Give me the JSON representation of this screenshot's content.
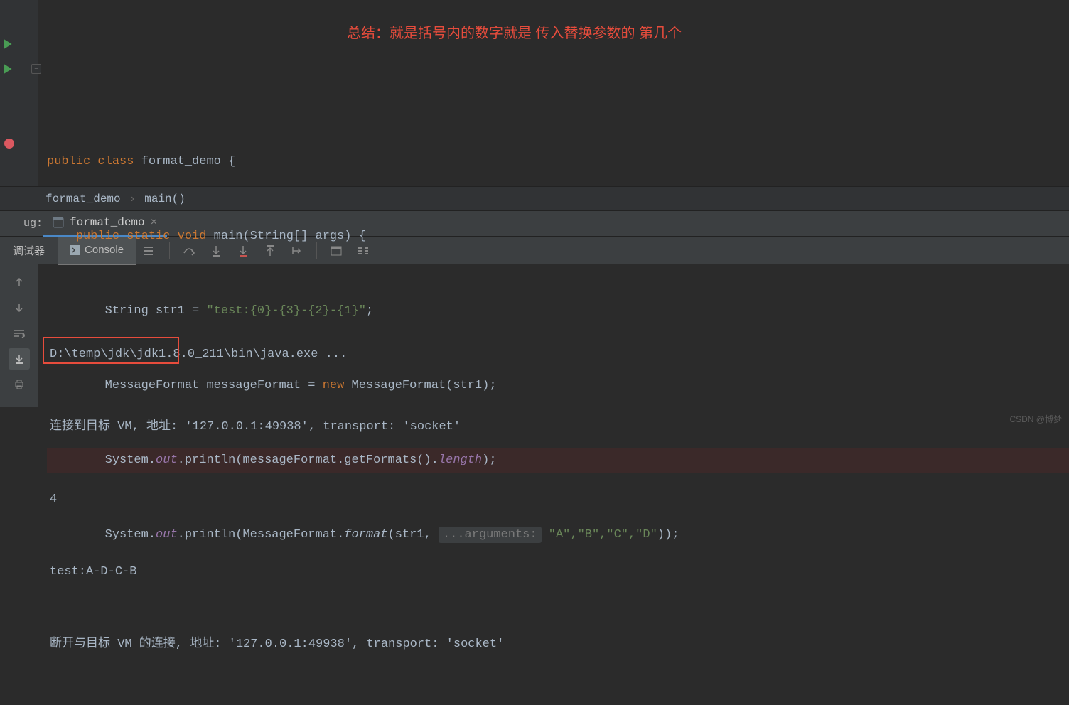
{
  "annotation": "总结：就是括号内的数字就是 传入替换参数的 第几个",
  "code": {
    "kw_public": "public",
    "kw_class": "class",
    "class_name": "format_demo",
    "kw_static": "static",
    "kw_void": "void",
    "main": "main",
    "main_params": "(String[] args) {",
    "l3_type": "String",
    "l3_var": "str1 = ",
    "l3_str": "\"test:{0}-{3}-{2}-{1}\"",
    "l3_end": ";",
    "l4_a": "MessageFormat messageFormat = ",
    "kw_new": "new",
    "l4_b": " MessageFormat(str1);",
    "l5_a": "System.",
    "l5_out": "out",
    "l5_b": ".println(messageFormat.getFormats().",
    "l5_len": "length",
    "l5_c": ");",
    "l6_a": "System.",
    "l6_b": ".println(MessageFormat.",
    "l6_fmt": "format",
    "l6_c": "(str1, ",
    "l6_hint": "...arguments:",
    "l6_d": " ",
    "l6_args": "\"A\",\"B\",\"C\",\"D\"",
    "l6_e": "));"
  },
  "breadcrumb": {
    "item1": "format_demo",
    "item2": "main()"
  },
  "debug": {
    "side_label": "ug:",
    "tab_name": "format_demo"
  },
  "toolbar": {
    "tab_debugger": "调试器",
    "tab_console": "Console"
  },
  "console": {
    "l1": "D:\\temp\\jdk\\jdk1.8.0_211\\bin\\java.exe ...",
    "l2": "连接到目标 VM, 地址: '127.0.0.1:49938', transport: 'socket'",
    "l3": "4",
    "l4": "test:A-D-C-B",
    "l5": "断开与目标 VM 的连接, 地址: '127.0.0.1:49938', transport: 'socket'"
  },
  "watermark": "CSDN @博梦"
}
